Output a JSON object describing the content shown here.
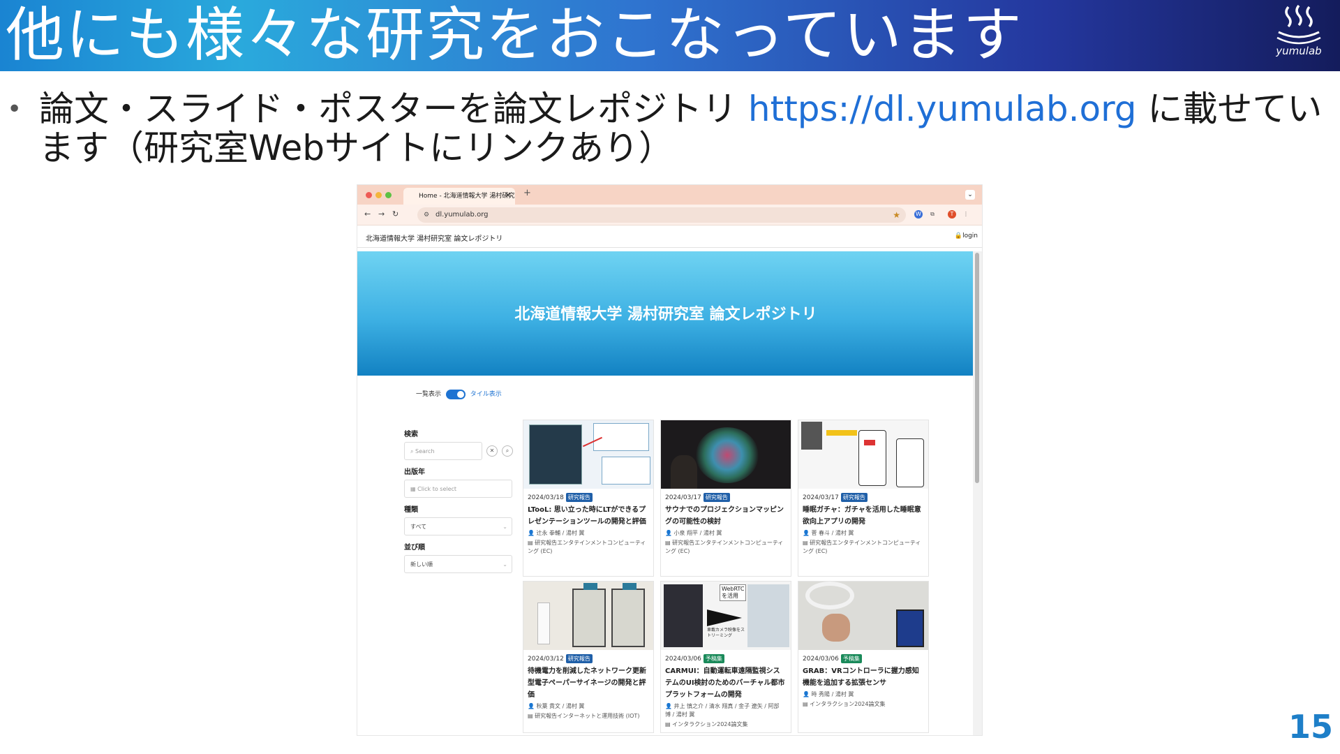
{
  "slide": {
    "title": "他にも様々な研究をおこなっています",
    "logo_text": "yumulab",
    "bullet_prefix": "論文・スライド・ポスターを論文レポジトリ ",
    "bullet_url": "https://dl.yumulab.org",
    "bullet_suffix": " に載せています（研究室Webサイトにリンクあり）",
    "page_number": "15"
  },
  "browser": {
    "tab_title": "Home - 北海道情報大学 湯村研究室",
    "url": "dl.yumulab.org",
    "site_name": "北海道情報大学 湯村研究室 論文レポジトリ",
    "login_label": "login",
    "hero_title": "北海道情報大学 湯村研究室 論文レポジトリ",
    "toggle_left": "一覧表示",
    "toggle_right": "タイル表示",
    "filters": {
      "search_label": "検索",
      "search_placeholder": "Search",
      "year_label": "出版年",
      "year_placeholder": "Click to select",
      "type_label": "種類",
      "type_value": "すべて",
      "sort_label": "並び順",
      "sort_value": "新しい順"
    },
    "cards": [
      {
        "date": "2024/03/18",
        "badge": "研究報告",
        "badge_kind": "report",
        "title": "LTooL: 思い立った時にLTができるプレゼンテーションツールの開発と評価",
        "authors": "辻永 拳輔 / 湯村 翼",
        "venue": "研究報告エンタテインメントコンピューティング (EC)"
      },
      {
        "date": "2024/03/17",
        "badge": "研究報告",
        "badge_kind": "report",
        "title": "サウナでのプロジェクションマッピングの可能性の検討",
        "authors": "小泉 翔平 / 湯村 翼",
        "venue": "研究報告エンタテインメントコンピューティング (EC)"
      },
      {
        "date": "2024/03/17",
        "badge": "研究報告",
        "badge_kind": "report",
        "title": "睡眠ガチャ：ガチャを活用した睡眠意欲向上アプリの開発",
        "authors": "菅 春斗 / 湯村 翼",
        "venue": "研究報告エンタテインメントコンピューティング (EC)"
      },
      {
        "date": "2024/03/12",
        "badge": "研究報告",
        "badge_kind": "report",
        "title": "待機電力を削減したネットワーク更新型電子ペーパーサイネージの開発と評価",
        "authors": "秋葉 貴文 / 湯村 翼",
        "venue": "研究報告インターネットと運用技術 (IOT)"
      },
      {
        "date": "2024/03/06",
        "badge": "予稿集",
        "badge_kind": "proc",
        "title": "CARMUI：自動運転車遠隔監視システムのUI検討のためのバーチャル都市プラットフォームの開発",
        "authors": "井上 慎之介 / 清水 翔真 / 金子 遼矢 / 阿部 博 / 湯村 翼",
        "venue": "インタラクション2024論文集"
      },
      {
        "date": "2024/03/06",
        "badge": "予稿集",
        "badge_kind": "proc",
        "title": "GRAB：VRコントローラに握力感知機能を追加する拡張センサ",
        "authors": "時 秀陽 / 湯村 翼",
        "venue": "インタラクション2024論文集"
      }
    ],
    "thumb_texts": {
      "card5_label1": "WebRTC",
      "card5_label2": "を活用",
      "card5_label3": "車載カメラ映像をストリーミング"
    }
  }
}
